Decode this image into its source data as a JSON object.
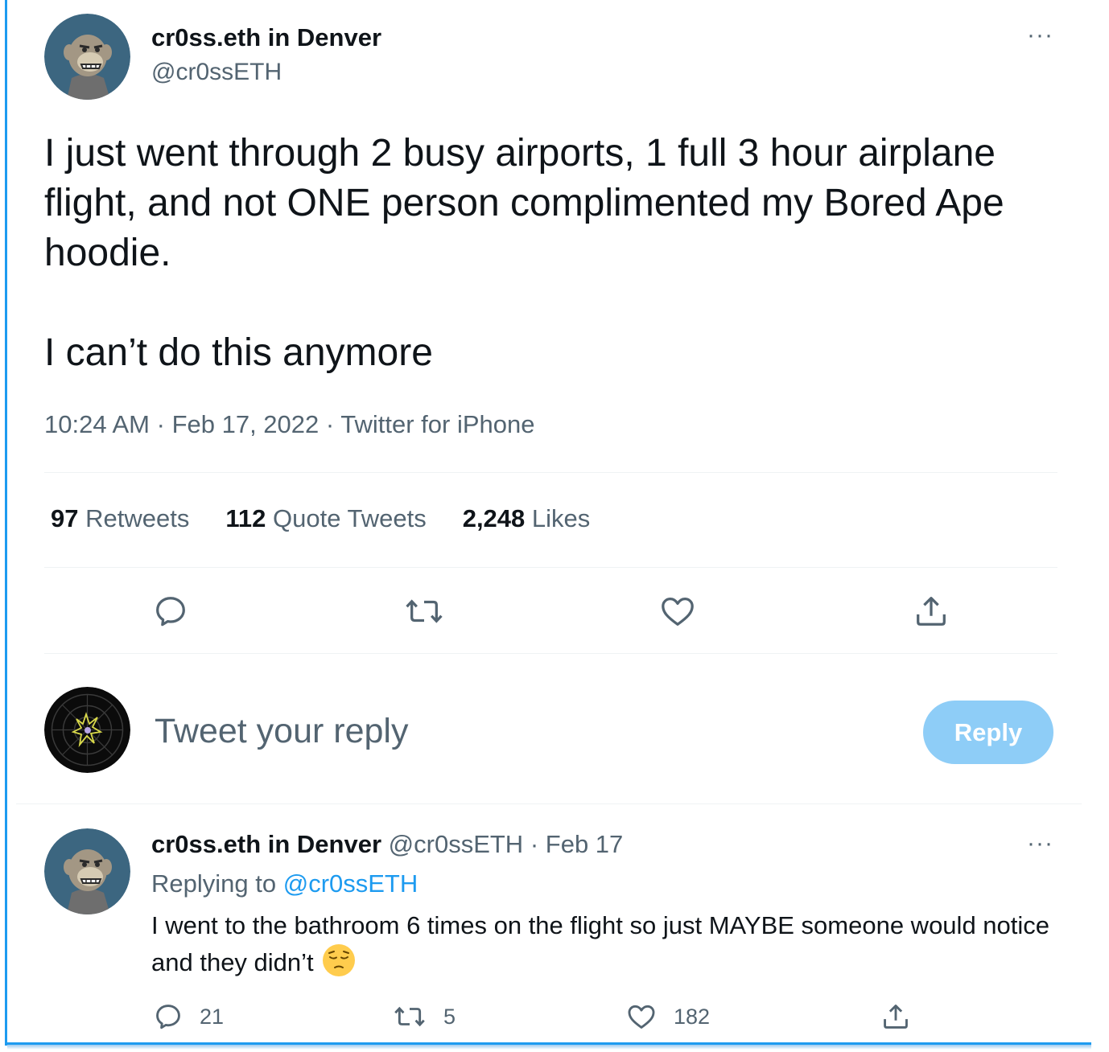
{
  "tweet": {
    "author_name": "cr0ss.eth in Denver",
    "author_handle": "@cr0ssETH",
    "text_p1": "I just went through 2 busy airports, 1 full 3 hour airplane flight, and not ONE person complimented my Bored Ape hoodie.",
    "text_p2": "I can’t do this anymore",
    "time": "10:24 AM",
    "date": "Feb 17, 2022",
    "source": "Twitter for iPhone",
    "separator": "·",
    "stats": {
      "retweets_count": "97",
      "retweets_label": "Retweets",
      "quotes_count": "112",
      "quotes_label": "Quote Tweets",
      "likes_count": "2,248",
      "likes_label": "Likes"
    },
    "more_label": "···"
  },
  "compose": {
    "placeholder": "Tweet your reply",
    "button_label": "Reply"
  },
  "reply": {
    "author_name": "cr0ss.eth in Denver",
    "author_handle": "@cr0ssETH",
    "date": "Feb 17",
    "replying_prefix": "Replying to",
    "replying_handle": "@cr0ssETH",
    "text": "I went to the bathroom 6 times on the flight so just MAYBE someone would notice and they didn’t",
    "emoji": "pensive-face",
    "reply_count": "21",
    "retweet_count": "5",
    "like_count": "182",
    "more_label": "···"
  },
  "icons": [
    "reply-icon",
    "retweet-icon",
    "like-icon",
    "share-icon",
    "pensive-face-emoji"
  ],
  "colors": {
    "accent": "#1d9bf0",
    "secondary_text": "#536471",
    "reply_button_disabled": "#8ecdf7",
    "avatar_bg": "#3c6680"
  }
}
